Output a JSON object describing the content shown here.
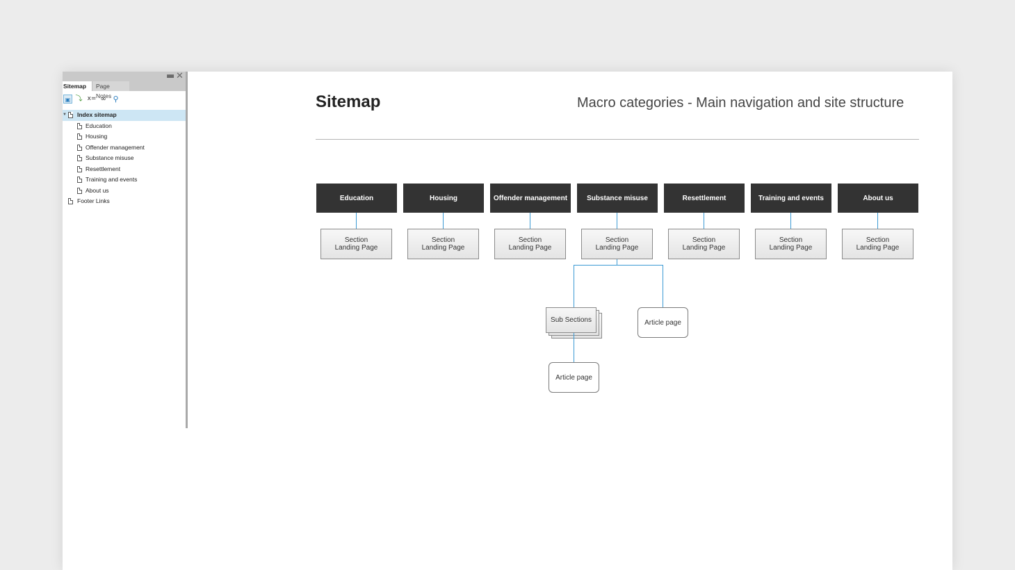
{
  "panel": {
    "tabs": [
      {
        "label": "Sitemap",
        "active": true
      },
      {
        "label": "Page Notes",
        "active": false
      }
    ],
    "controls": {
      "minimize": "▬",
      "close": "✕"
    },
    "toolbar": [
      {
        "icon": "add-page-icon",
        "glyph": "▣"
      },
      {
        "icon": "add-child-icon",
        "glyph": "⤵"
      },
      {
        "icon": "variables-icon",
        "glyph": "x="
      },
      {
        "icon": "link-icon",
        "glyph": "∞"
      },
      {
        "icon": "search-icon",
        "glyph": "⚲"
      }
    ],
    "tree": {
      "root": {
        "label": "Index sitemap",
        "expanded": true,
        "twisty": "▼"
      },
      "children": [
        "Education",
        "Housing",
        "Offender management",
        "Substance misuse",
        "Resettlement",
        "Training and events",
        "About us"
      ],
      "sibling": "Footer Links"
    }
  },
  "main": {
    "title": "Sitemap",
    "subtitle": "Macro categories - Main navigation and site structure",
    "categories": [
      "Education",
      "Housing",
      "Offender management",
      "Substance misuse",
      "Resettlement",
      "Training and events",
      "About us"
    ],
    "landing_line1": "Section",
    "landing_line2": "Landing Page",
    "sub_sections": "Sub Sections",
    "article_page": "Article page",
    "connector_color": "#3b9ad4"
  }
}
